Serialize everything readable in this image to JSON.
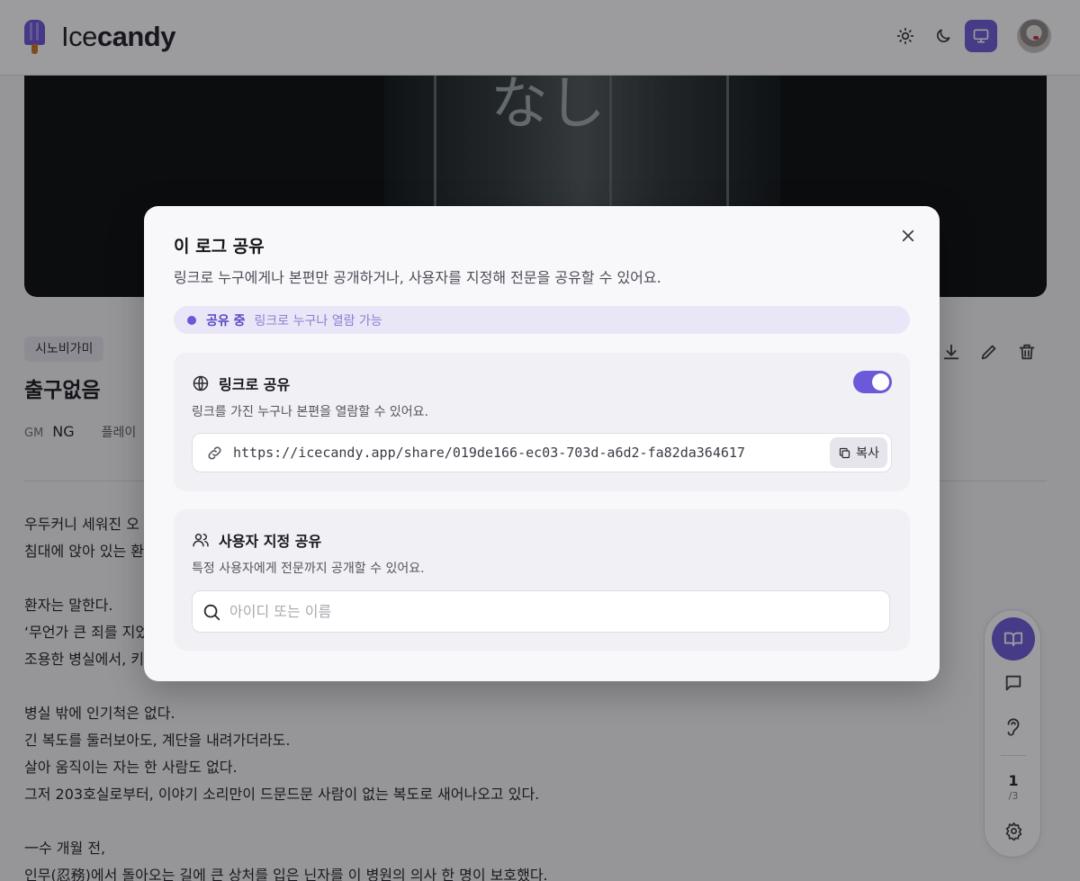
{
  "header": {
    "brand_light": "Ice",
    "brand_bold": "candy",
    "icons": [
      "sun-icon",
      "moon-icon",
      "monitor-icon"
    ],
    "active_theme": "monitor"
  },
  "hero": {
    "glyph": "なし"
  },
  "log": {
    "tag": "시노비가미",
    "title": "출구없음",
    "gm_label": "GM",
    "gm_value": "NG",
    "player_label": "플레이"
  },
  "body_lines": [
    "우두커니 세워진 오",
    "침대에 앉아 있는 환",
    "",
    "환자는 말한다.",
    "‘무언가 큰 죄를 지었",
    "조용한 병실에서, 키",
    "",
    "병실 밖에 인기척은 없다.",
    "긴 복도를 둘러보아도, 계단을 내려가더라도.",
    "살아 움직이는 자는 한 사람도 없다.",
    "그저 203호실로부터, 이야기 소리만이 드문드문 사람이 없는 복도로 새어나오고 있다.",
    "",
    "一수 개월 전,",
    "인무(忍務)에서 돌아오는 길에 큰 상처를 입은 닌자를 이 병원의 의사 한 명이 보호했다."
  ],
  "side_rail": {
    "page_current": "1",
    "page_total": "/3"
  },
  "modal": {
    "title": "이 로그 공유",
    "description": "링크로 누구에게나 본편만 공개하거나, 사용자를 지정해 전문을 공유할 수 있어요.",
    "status": {
      "label": "공유 중",
      "detail": "링크로 누구나 열람 가능"
    },
    "link_share": {
      "title": "링크로 공유",
      "description": "링크를 가진 누구나 본편을 열람할 수 있어요.",
      "enabled": true,
      "url": "https://icecandy.app/share/019de166-ec03-703d-a6d2-fa82da364617",
      "copy_label": "복사"
    },
    "user_share": {
      "title": "사용자 지정 공유",
      "description": "특정 사용자에게 전문까지 공개할 수 있어요.",
      "search_placeholder": "아이디 또는 이름"
    }
  },
  "colors": {
    "accent": "#6a59d8",
    "status_bg": "#e9e7f7"
  }
}
